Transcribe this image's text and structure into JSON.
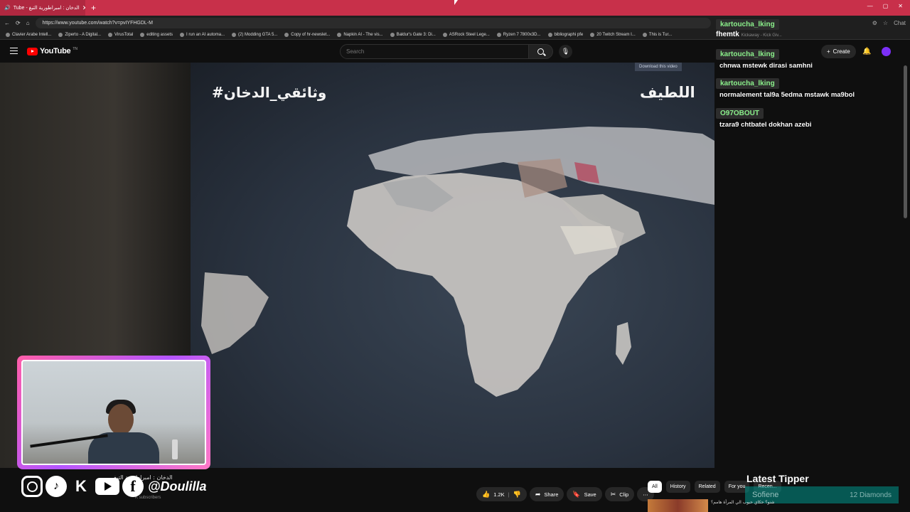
{
  "browser": {
    "tab_title": "Tube - الدخان : امبراطورية التبغ",
    "url": "https://www.youtube.com/watch?v=pvIYFHGDL-M",
    "bookmarks": [
      "Clavier Arabe Intell...",
      "Ziperto - A Digital...",
      "VirusTotal",
      "editing assets",
      "I run an AI automa...",
      "(2) Modding GTA 5...",
      "Copy of hr-newslet...",
      "Napkin AI - The vis...",
      "Baldur's Gate 3: Di...",
      "ASRock Steel Lege...",
      "Ryzen 7 7800x3D...",
      "bibliographi pfe",
      "20 Twitch Stream I...",
      "This is Tur..."
    ],
    "chat_button": "Chat"
  },
  "youtube": {
    "logo_text": "YouTube",
    "logo_tm": "TN",
    "search_placeholder": "Search",
    "create_label": "Create",
    "download_hint": "Download this video"
  },
  "video": {
    "hashtag_overlay": "#وثائقي_الدخان",
    "brand_overlay": "اللطيف",
    "title_small": "الدخان : امبراطورية التبغ",
    "subscribers": "K subscribers"
  },
  "chat": {
    "top_user": "kartoucha_lking",
    "second_user": "fhemtk",
    "second_meta": "Kickaway - Kick Giv...",
    "messages": [
      {
        "user": "kartoucha_lking",
        "text": "chnwa mstewk dirasi samhni"
      },
      {
        "user": "kartoucha_lking",
        "text": "normalement tal9a 5edma mstawk ma9bol"
      },
      {
        "user": "O97OBOUT",
        "text": "tzara9 chtbatel dokhan azebi"
      }
    ]
  },
  "actions": {
    "like_count": "1.2K",
    "share": "Share",
    "save": "Save",
    "clip": "Clip"
  },
  "chips": [
    "All",
    "History",
    "Related",
    "For you",
    "Recen..."
  ],
  "socials": {
    "handle": "@Doulilla"
  },
  "tipper": {
    "title": "Latest Tipper",
    "name": "Sofiene",
    "amount": "12 Diamonds"
  },
  "recommendation": {
    "text": "شنو؟ حكاي حبوب الي المرأة هامم؟"
  }
}
